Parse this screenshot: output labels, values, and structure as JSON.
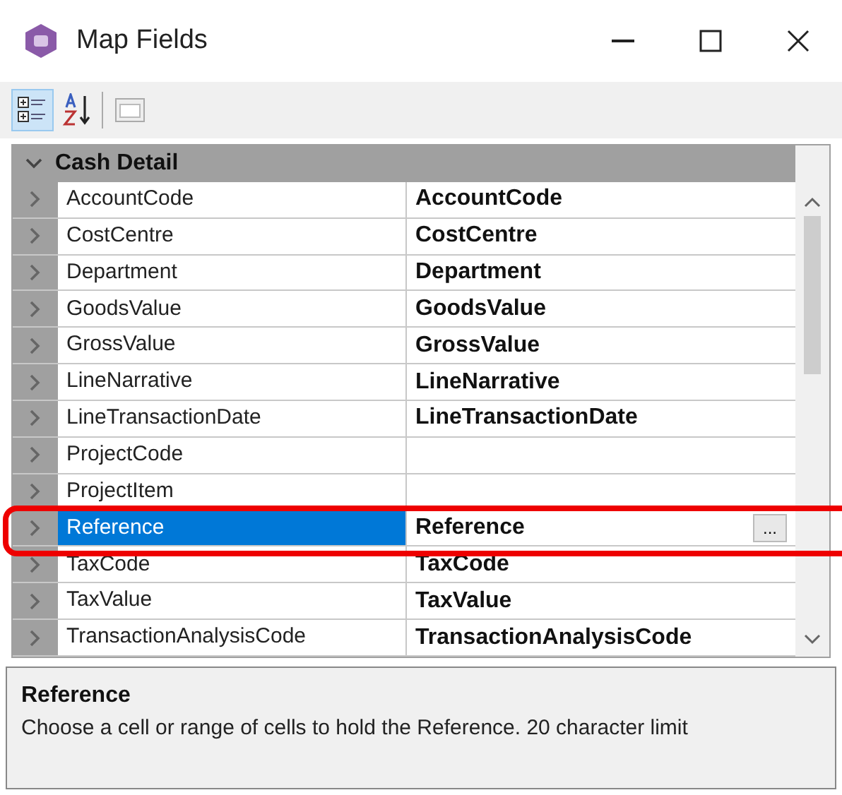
{
  "window": {
    "title": "Map Fields"
  },
  "toolbar": [
    {
      "kind": "categorized",
      "selected": true
    },
    {
      "kind": "alphabetical",
      "selected": false
    },
    {
      "kind": "pages",
      "selected": false
    }
  ],
  "category": {
    "label": "Cash Detail",
    "expanded": true
  },
  "rows": [
    {
      "name": "AccountCode",
      "value": "AccountCode",
      "selected": false
    },
    {
      "name": "CostCentre",
      "value": "CostCentre",
      "selected": false
    },
    {
      "name": "Department",
      "value": "Department",
      "selected": false
    },
    {
      "name": "GoodsValue",
      "value": "GoodsValue",
      "selected": false
    },
    {
      "name": "GrossValue",
      "value": "GrossValue",
      "selected": false
    },
    {
      "name": "LineNarrative",
      "value": "LineNarrative",
      "selected": false
    },
    {
      "name": "LineTransactionDate",
      "value": "LineTransactionDate",
      "selected": false
    },
    {
      "name": "ProjectCode",
      "selected": false
    },
    {
      "name": "ProjectItem",
      "selected": false
    },
    {
      "name": "Reference",
      "value": "Reference",
      "selected": true,
      "button": "..."
    },
    {
      "name": "TaxCode",
      "value": "TaxCode",
      "selected": false
    },
    {
      "name": "TaxValue",
      "value": "TaxValue",
      "selected": false
    },
    {
      "name": "TransactionAnalysisCode",
      "value": "TransactionAnalysisCode",
      "selected": false
    }
  ],
  "description": {
    "title": "Reference",
    "text": "Choose a cell or range of cells to hold the Reference. 20 character limit"
  }
}
